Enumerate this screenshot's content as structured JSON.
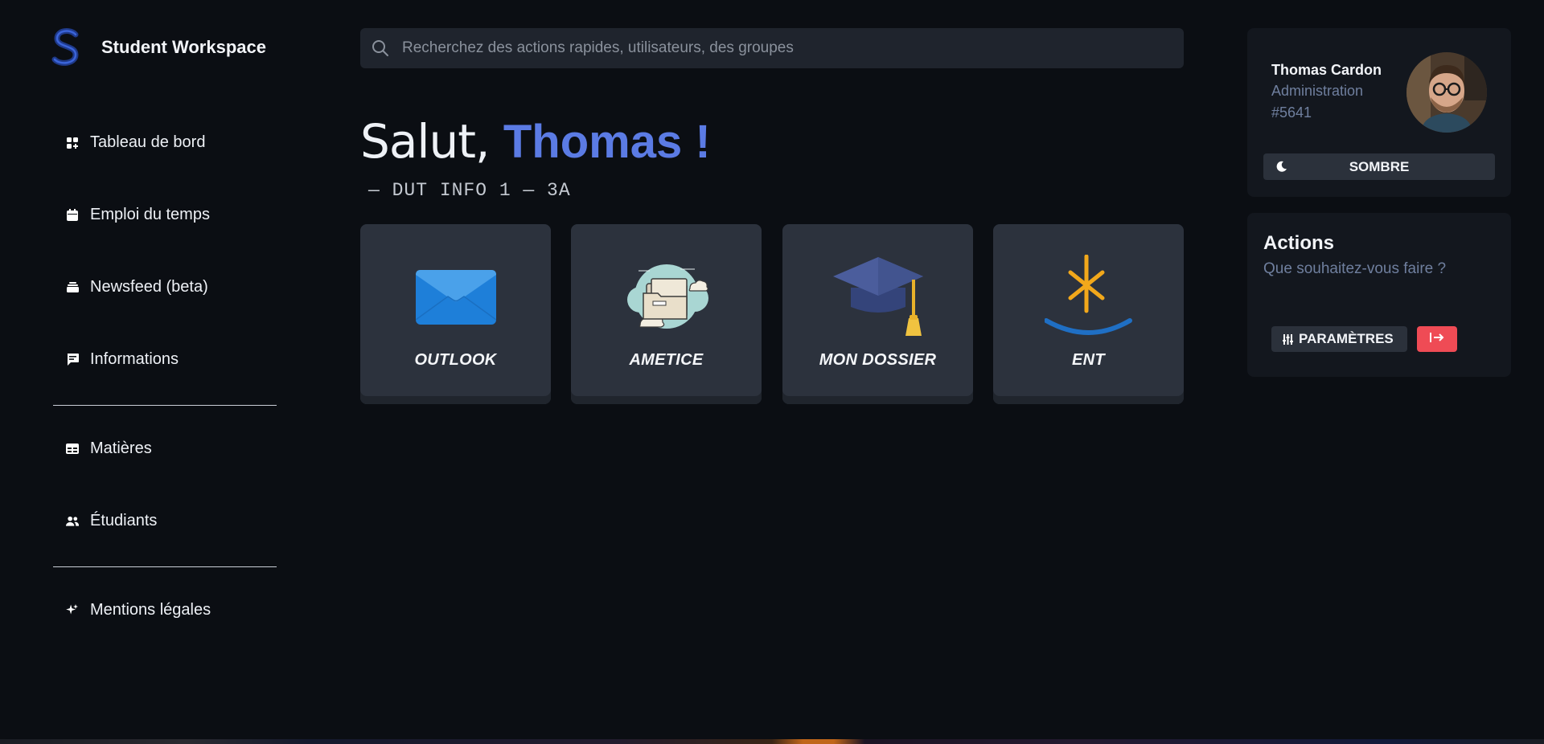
{
  "brand": {
    "title": "Student Workspace"
  },
  "sidebar": {
    "items": [
      {
        "label": "Tableau de bord",
        "icon": "dashboard-icon"
      },
      {
        "label": "Emploi du temps",
        "icon": "calendar-icon"
      },
      {
        "label": "Newsfeed (beta)",
        "icon": "inbox-icon"
      },
      {
        "label": "Informations",
        "icon": "message-icon"
      },
      {
        "label": "Matières",
        "icon": "table-icon"
      },
      {
        "label": "Étudiants",
        "icon": "users-icon"
      },
      {
        "label": "Mentions légales",
        "icon": "sparkle-icon"
      }
    ]
  },
  "search": {
    "placeholder": "Recherchez des actions rapides, utilisateurs, des groupes"
  },
  "greeting": {
    "hello": "Salut, ",
    "name": "Thomas !",
    "subtitle": "— DUT INFO 1 — 3A"
  },
  "tiles": [
    {
      "label": "OUTLOOK",
      "icon": "mail-icon"
    },
    {
      "label": "AMETICE",
      "icon": "cloud-folder-icon"
    },
    {
      "label": "MON DOSSIER",
      "icon": "graduation-cap-icon"
    },
    {
      "label": "ENT",
      "icon": "ent-asterisk-icon"
    }
  ],
  "profile": {
    "name": "Thomas Cardon",
    "role": "Administration",
    "id": "#5641",
    "theme_label": "SOMBRE"
  },
  "actions": {
    "title": "Actions",
    "subtitle": "Que souhaitez-vous faire ?",
    "settings_label": "PARAMÈTRES"
  },
  "colors": {
    "background": "#0b0e13",
    "accent": "#5b7be4",
    "tile": "#2c323d",
    "card": "#13171e",
    "danger": "#ef4b55"
  }
}
